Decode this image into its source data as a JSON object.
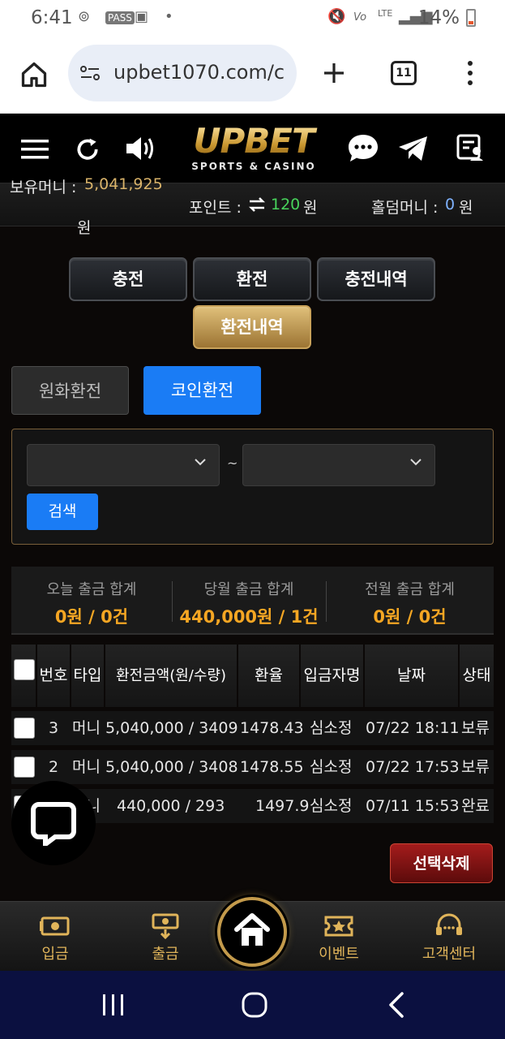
{
  "status_bar": {
    "time": "6:41",
    "battery": "14%"
  },
  "browser": {
    "url": "upbet1070.com/c",
    "tab_count": "11"
  },
  "header": {
    "logo_main": "UPBET",
    "logo_sub": "SPORTS & CASINO"
  },
  "info": {
    "money_label": "보유머니 :",
    "money_value": "5,041,925",
    "money_unit": "원",
    "point_label": "포인트 :",
    "point_value": "120",
    "point_unit": "원",
    "hold_label": "홀덤머니 :",
    "hold_value": "0",
    "hold_unit": "원"
  },
  "tabs": {
    "charge": "충전",
    "exchange": "환전",
    "charge_history": "충전내역",
    "exchange_history": "환전내역"
  },
  "sub_tabs": {
    "won": "원화환전",
    "coin": "코인환전"
  },
  "search": {
    "tilde": "~",
    "button": "검색"
  },
  "summary": [
    {
      "label": "오늘 출금 합계",
      "value": "0원 / 0건"
    },
    {
      "label": "당월 출금 합계",
      "value": "440,000원 / 1건"
    },
    {
      "label": "전월 출금 합계",
      "value": "0원 / 0건"
    }
  ],
  "table": {
    "headers": [
      "번호",
      "타입",
      "환전금액(원/수량)",
      "환율",
      "입금자명",
      "날짜",
      "상태"
    ],
    "rows": [
      {
        "no": "3",
        "type": "머니",
        "amount": "5,040,000 / 3409",
        "rate": "1478.43",
        "name": "심소정",
        "date": "07/22 18:11",
        "status": "보류"
      },
      {
        "no": "2",
        "type": "머니",
        "amount": "5,040,000 / 3408",
        "rate": "1478.55",
        "name": "심소정",
        "date": "07/22 17:53",
        "status": "보류"
      },
      {
        "no": "1",
        "type": "머니",
        "amount": "440,000 / 293",
        "rate": "1497.9",
        "name": "심소정",
        "date": "07/11 15:53",
        "status": "완료"
      }
    ]
  },
  "delete_button": "선택삭제",
  "bottom_nav": {
    "deposit": "입금",
    "withdraw": "출금",
    "event": "이벤트",
    "support": "고객센터"
  }
}
